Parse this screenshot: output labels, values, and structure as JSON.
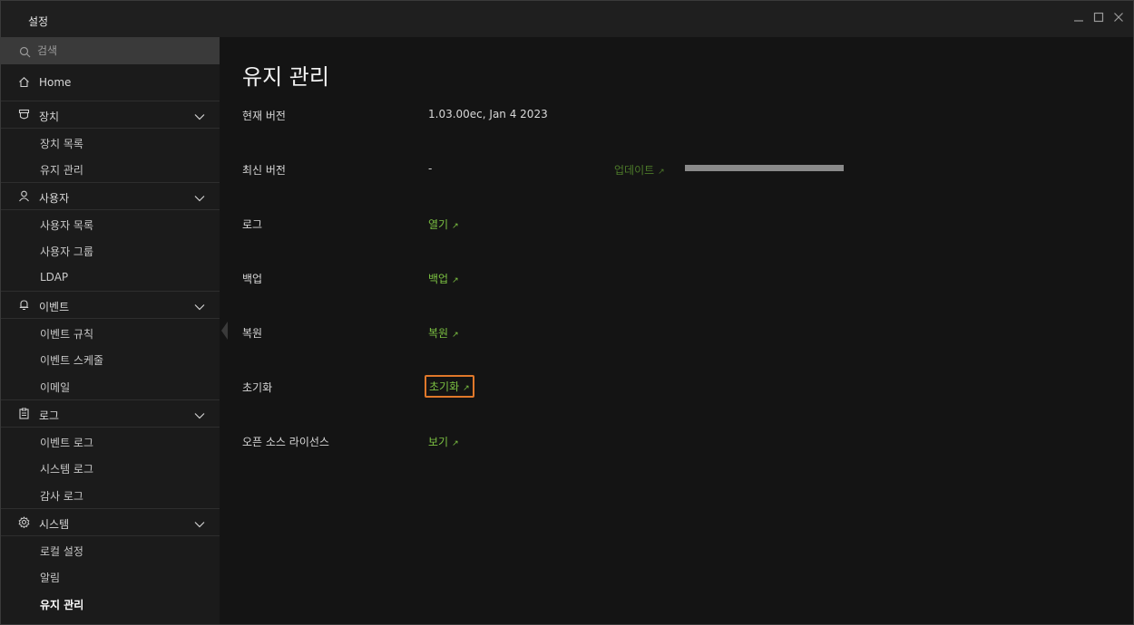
{
  "window": {
    "title": "설정"
  },
  "search": {
    "placeholder": "검색"
  },
  "sidebar": {
    "items": [
      {
        "label": "Home",
        "icon": "home-icon"
      },
      {
        "label": "장치",
        "icon": "device-icon"
      },
      {
        "label": "장치 목록"
      },
      {
        "label": "유지 관리"
      },
      {
        "label": "사용자",
        "icon": "user-icon"
      },
      {
        "label": "사용자 목록"
      },
      {
        "label": "사용자 그룹"
      },
      {
        "label": "LDAP"
      },
      {
        "label": "이벤트",
        "icon": "bell-icon"
      },
      {
        "label": "이벤트 규칙"
      },
      {
        "label": "이벤트 스케줄"
      },
      {
        "label": "이메일"
      },
      {
        "label": "로그",
        "icon": "clipboard-icon"
      },
      {
        "label": "이벤트 로그"
      },
      {
        "label": "시스템 로그"
      },
      {
        "label": "감사 로그"
      },
      {
        "label": "시스템",
        "icon": "gear-icon"
      },
      {
        "label": "로컬 설정"
      },
      {
        "label": "알림"
      },
      {
        "label": "유지 관리",
        "active": true
      }
    ]
  },
  "main": {
    "title": "유지 관리",
    "rows": [
      {
        "label": "현재 버전",
        "value": "1.03.00ec, Jan  4 2023"
      },
      {
        "label": "최신 버전",
        "value": "-",
        "action": "업데이트"
      },
      {
        "label": "로그",
        "action": "열기"
      },
      {
        "label": "백업",
        "action": "백업"
      },
      {
        "label": "복원",
        "action": "복원"
      },
      {
        "label": "초기화",
        "action": "초기화"
      },
      {
        "label": "오픈 소스 라이선스",
        "action": "보기"
      }
    ]
  },
  "colors": {
    "accent": "#7cc242",
    "focus": "#e0782a",
    "background": "#141414",
    "sidebar": "#1b1b1b"
  }
}
